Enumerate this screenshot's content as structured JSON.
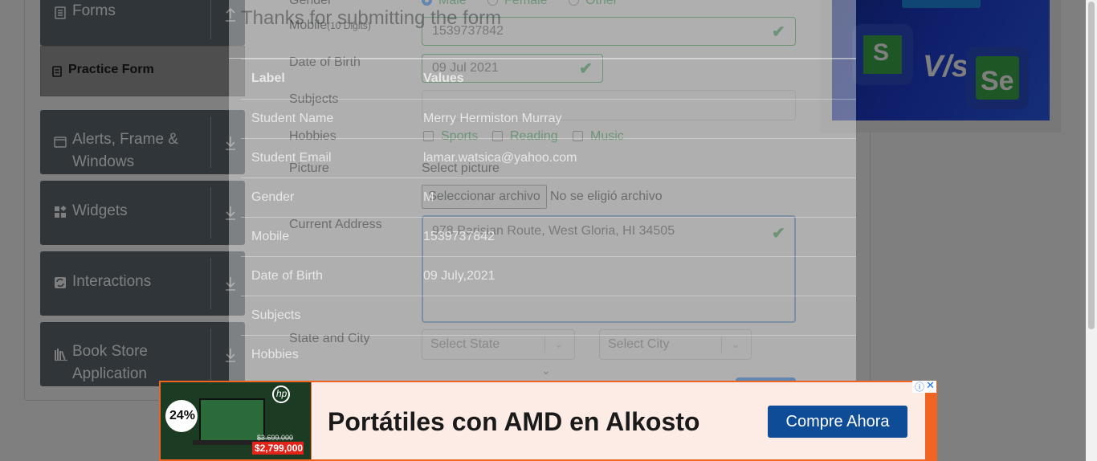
{
  "sidebar": {
    "groups": [
      {
        "label": "Forms",
        "icon": "form-icon"
      },
      {
        "label": "Alerts, Frame &",
        "label2": "Windows",
        "icon": "window-icon"
      },
      {
        "label": "Widgets",
        "icon": "widgets-icon"
      },
      {
        "label": "Interactions",
        "icon": "interactions-icon"
      },
      {
        "label": "Book Store",
        "label2": "Application",
        "icon": "books-icon"
      }
    ],
    "active_item": "Practice Form"
  },
  "form": {
    "gender_label": "Gender",
    "gender_options": [
      "Male",
      "Female",
      "Other"
    ],
    "mobile_label": "Mobile",
    "mobile_hint": "(10 Digits)",
    "mobile_value": "1539737842",
    "dob_label": "Date of Birth",
    "dob_value": "09 Jul 2021",
    "subjects_label": "Subjects",
    "hobbies_label": "Hobbies",
    "hobbies": [
      "Sports",
      "Reading",
      "Music"
    ],
    "picture_label": "Picture",
    "picture_select_label": "Select picture",
    "file_button": "Seleccionar archivo",
    "file_status": "No se eligió archivo",
    "address_label": "Current Address",
    "address_value": "978 Parisian Route, West Gloria, HI 34505",
    "state_city_label": "State and City",
    "state_placeholder": "Select State",
    "city_placeholder": "Select City"
  },
  "modal": {
    "title": "Thanks for submitting the form",
    "header": {
      "label": "Label",
      "values": "Values"
    },
    "rows": [
      {
        "label": "Student Name",
        "value": "Merry Hermiston Murray"
      },
      {
        "label": "Student Email",
        "value": "lamar.watsica@yahoo.com"
      },
      {
        "label": "Gender",
        "value": "M"
      },
      {
        "label": "Mobile",
        "value": "1539737842"
      },
      {
        "label": "Date of Birth",
        "value": "09 July,2021"
      },
      {
        "label": "Subjects",
        "value": ""
      },
      {
        "label": "Hobbies",
        "value": ""
      }
    ]
  },
  "side_ad": {
    "logo_left": "S",
    "versus": "V/s",
    "logo_right": "Se"
  },
  "banner": {
    "discount": "24%",
    "brand": "hp",
    "price_old": "$3.699.000",
    "price_new": "$2,799,000",
    "headline": "Portátiles con AMD en Alkosto",
    "cta": "Compre Ahora"
  },
  "colors": {
    "sidebar_bg": "#5f6a72",
    "accent_green": "#28a745",
    "banner_orange": "#f16522",
    "cta_blue": "#0f4c97"
  }
}
